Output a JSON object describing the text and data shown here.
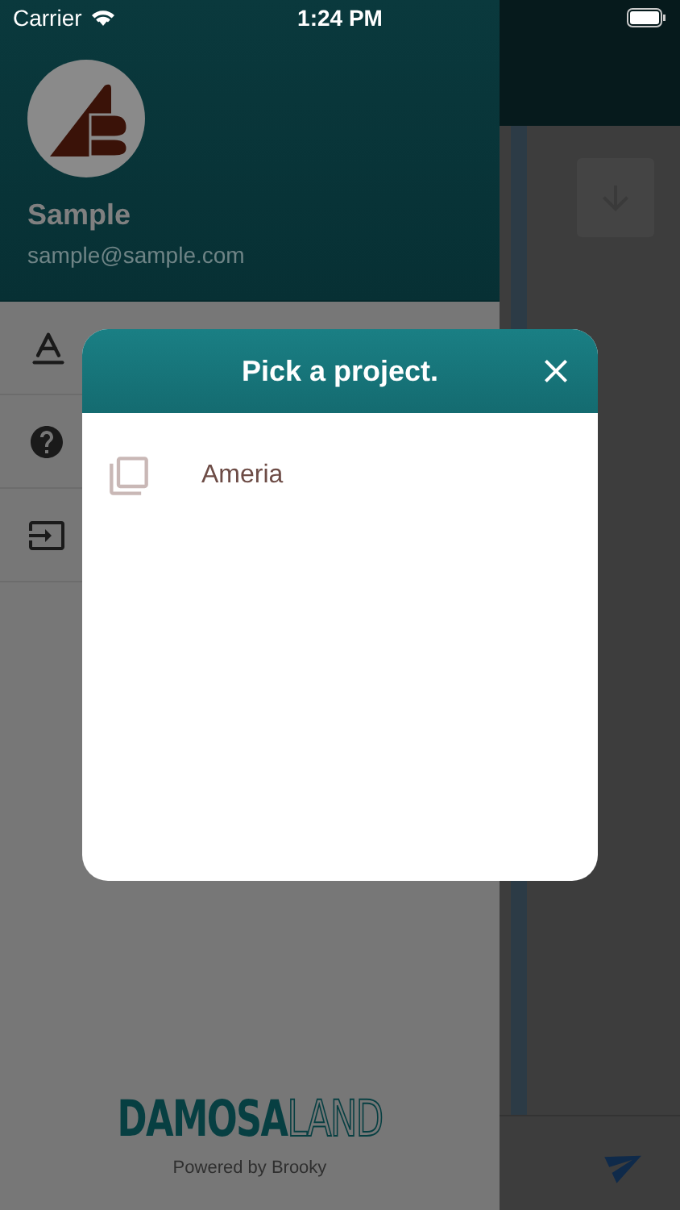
{
  "status_bar": {
    "carrier": "Carrier",
    "time": "1:24 PM"
  },
  "drawer": {
    "user": {
      "name": "Sample",
      "email": "sample@sample.com"
    },
    "menu": [
      {
        "kind": "font"
      },
      {
        "kind": "help"
      },
      {
        "kind": "logout"
      }
    ],
    "brand": {
      "bold": "DAMOSA",
      "outline": "LAND"
    },
    "footer": "Powered by Brooky"
  },
  "dialog": {
    "title": "Pick a project.",
    "items": [
      {
        "label": "Ameria"
      }
    ]
  }
}
